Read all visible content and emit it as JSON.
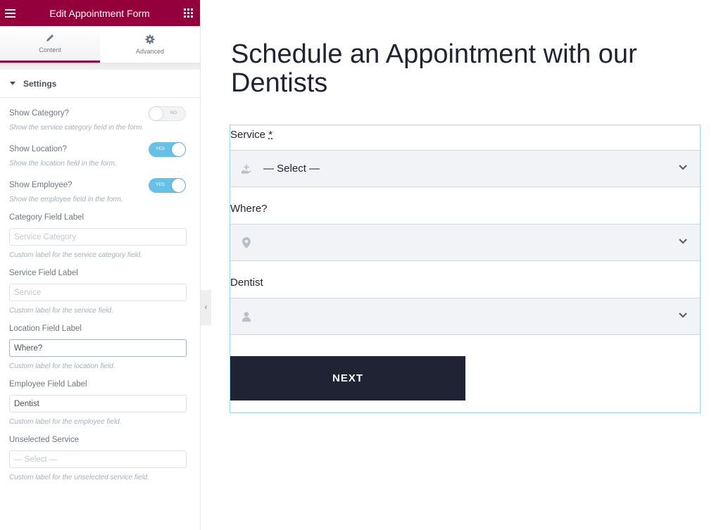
{
  "panel": {
    "title": "Edit Appointment Form",
    "tabs": [
      {
        "label": "Content",
        "icon": "pencil-icon",
        "active": true
      },
      {
        "label": "Advanced",
        "icon": "gear-icon",
        "active": false
      }
    ],
    "section_title": "Settings",
    "switches": [
      {
        "label": "Show Category?",
        "state": "NO",
        "on": false,
        "desc": "Show the service category field in the form."
      },
      {
        "label": "Show Location?",
        "state": "YES",
        "on": true,
        "desc": "Show the location field in the form."
      },
      {
        "label": "Show Employee?",
        "state": "YES",
        "on": true,
        "desc": "Show the employee field in the form."
      }
    ],
    "text_fields": [
      {
        "label": "Category Field Label",
        "value": "",
        "placeholder": "Service Category",
        "desc": "Custom label for the service category field."
      },
      {
        "label": "Service Field Label",
        "value": "",
        "placeholder": "Service",
        "desc": "Custom label for the service field."
      },
      {
        "label": "Location Field Label",
        "value": "Where?",
        "placeholder": "",
        "desc": "Custom label for the location field."
      },
      {
        "label": "Employee Field Label",
        "value": "Dentist",
        "placeholder": "",
        "desc": "Custom label for the employee field."
      },
      {
        "label": "Unselected Service",
        "value": "",
        "placeholder": "— Select —",
        "desc": "Custom label for the unselected service field."
      }
    ],
    "accent_color": "#93003c",
    "switch_on_color": "#65c1e6"
  },
  "preview": {
    "heading": "Schedule an Appointment with our Dentists",
    "fields": [
      {
        "label": "Service",
        "required_mark": "*",
        "icon": "service-hand-plus-icon",
        "value": "— Select —"
      },
      {
        "label": "Where?",
        "icon": "location-pin-icon",
        "value": ""
      },
      {
        "label": "Dentist",
        "icon": "user-icon",
        "value": ""
      }
    ],
    "next_button": "NEXT",
    "button_color": "#1f2333"
  }
}
